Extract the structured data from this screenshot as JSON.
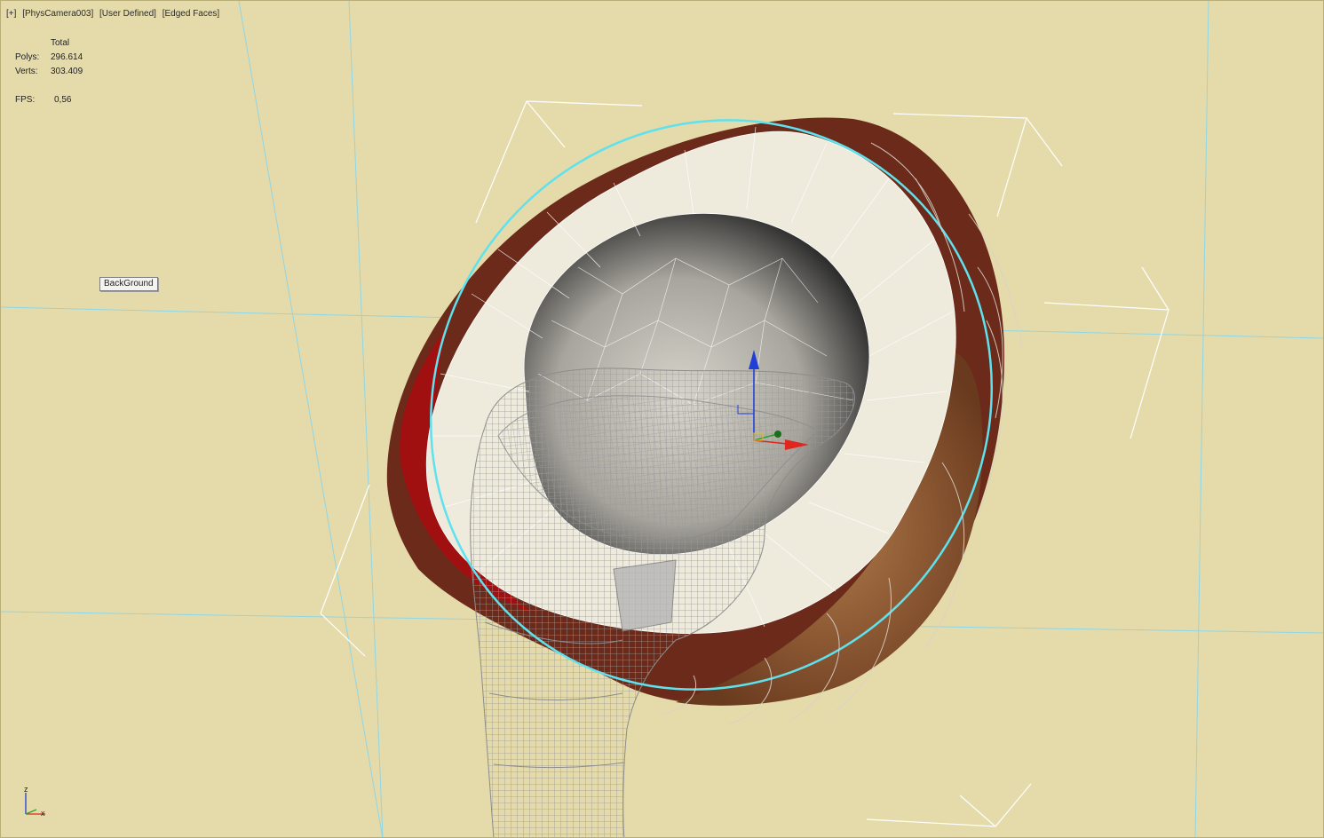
{
  "viewport": {
    "label_parts": [
      "[+]",
      "[PhysCamera003]",
      "[User Defined]",
      "[Edged Faces]"
    ],
    "stats": {
      "header": "Total",
      "polys_label": "Polys:",
      "polys_value": "296.614",
      "verts_label": "Verts:",
      "verts_value": "303.409",
      "fps_label": "FPS:",
      "fps_value": "0,56"
    },
    "tooltip": "BackGround",
    "axis_labels": {
      "z": "z",
      "x": "x"
    },
    "colors": {
      "background": "#e5dbaa",
      "grid_lines": "#8fd6e6",
      "selection_ring": "#5fe1ee",
      "shell": "#6b2a1a",
      "flesh": "#eeeadc",
      "wireframe": "#9b9b9b",
      "gizmo_x": "#e0261f",
      "gizmo_y": "#2ea12e",
      "gizmo_z": "#1f3fd6"
    }
  }
}
